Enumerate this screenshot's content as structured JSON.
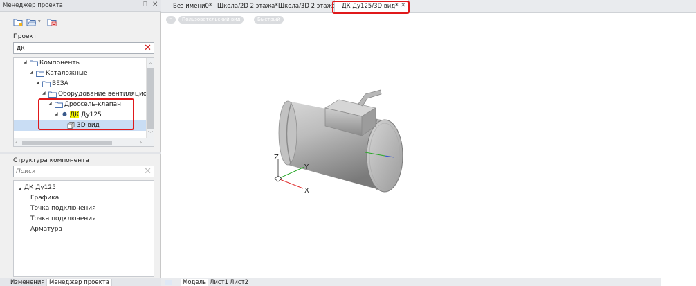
{
  "project_manager": {
    "title": "Менеджер проекта",
    "pin_glyph": "⎕",
    "close_glyph": "✕",
    "project_label": "Проект",
    "filter_value": "дк",
    "clear_glyph": "✕",
    "tree": {
      "components": "Компоненты",
      "catalog": "Каталожные",
      "veza": "ВЕЗА",
      "ventilation": "Оборудование вентиляционно",
      "throttle_valve": "Дроссель-клапан",
      "dk_prefix": "ДК",
      "dk_suffix": " Ду125",
      "view_3d": "3D вид"
    }
  },
  "component_structure": {
    "label": "Структура компонента",
    "search_placeholder": "Поиск",
    "clear_glyph": "✕",
    "root": "ДК Ду125",
    "items": [
      "Графика",
      "Точка подключения",
      "Точка подключения",
      "Арматура"
    ]
  },
  "left_tabs": {
    "changes": "Изменения",
    "project_manager": "Менеджер проекта"
  },
  "document_tabs": [
    {
      "label": "Без имени0*"
    },
    {
      "label": "Школа/2D 2 этажа*"
    },
    {
      "label": "Школа/3D 2 этажа*"
    },
    {
      "label": "ДК Ду125/3D вид*",
      "active": true
    }
  ],
  "tab_close_glyph": "✕",
  "view_controls": {
    "minus": "−",
    "view": "Пользовательский вид",
    "style": "Быстрый"
  },
  "axes": {
    "x": "X",
    "y": "Y",
    "z": "Z"
  },
  "bottom_tabs": {
    "model": "Модель",
    "sheet1": "Лист1",
    "sheet2": "Лист2"
  },
  "colors": {
    "highlight_box": "#e0191b",
    "search_highlight": "#f5f500",
    "selection": "#c9ddf4"
  }
}
